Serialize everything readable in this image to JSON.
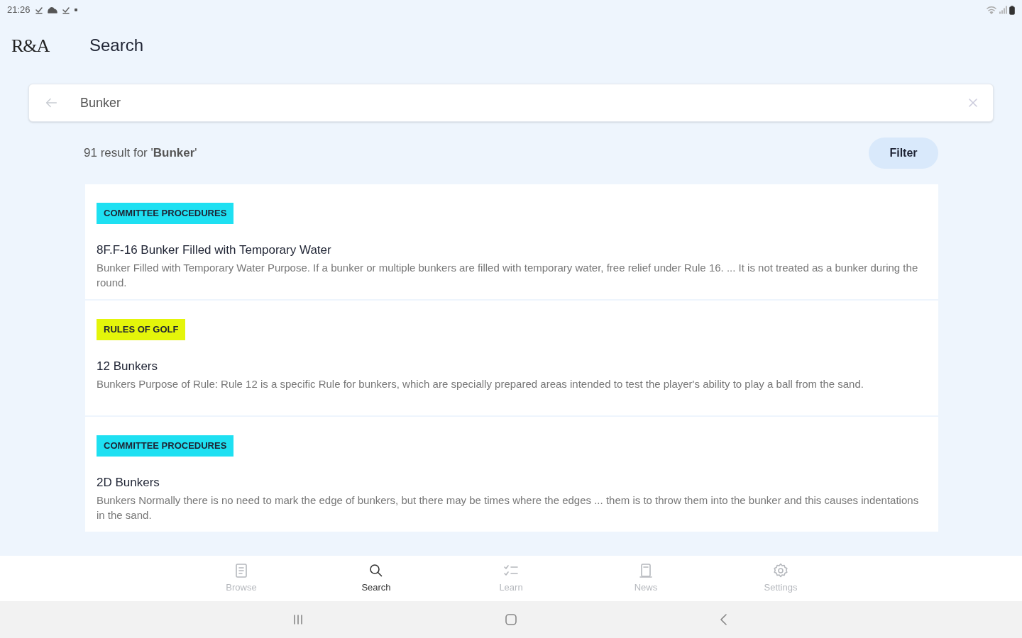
{
  "status_bar": {
    "time": "21:26"
  },
  "header": {
    "logo": "R&A",
    "title": "Search"
  },
  "search": {
    "value": "Bunker"
  },
  "results_summary": "91 result for '**Bunker**'",
  "filter_button": "Filter",
  "results": [
    {
      "tag": "COMMITTEE PROCEDURES",
      "color": "#1ee0f2",
      "title": "8F.F-16 Bunker Filled with Temporary Water",
      "snippet": "Bunker Filled with Temporary Water Purpose. If a bunker or multiple bunkers are filled with temporary water, free relief under Rule 16. ... It is not treated as a bunker during the round."
    },
    {
      "tag": "RULES OF GOLF",
      "color": "#e4f50a",
      "title": "12 Bunkers",
      "snippet": "Bunkers Purpose of Rule: Rule 12 is a specific Rule for bunkers, which are specially prepared areas intended to test the player's ability to play a ball from the sand."
    },
    {
      "tag": "COMMITTEE PROCEDURES",
      "color": "#1ee0f2",
      "title": "2D Bunkers",
      "snippet": "Bunkers Normally there is no need to mark the edge of bunkers, but there may be times where the edges ... them is to throw them into the bunker and this causes indentations in the sand."
    }
  ],
  "bottom_nav": [
    {
      "kind": "browse",
      "label": "Browse",
      "selected": false
    },
    {
      "kind": "search",
      "label": "Search",
      "selected": true
    },
    {
      "kind": "learn",
      "label": "Learn",
      "selected": false
    },
    {
      "kind": "news",
      "label": "News",
      "selected": false
    },
    {
      "kind": "settings",
      "label": "Settings",
      "selected": false
    }
  ]
}
